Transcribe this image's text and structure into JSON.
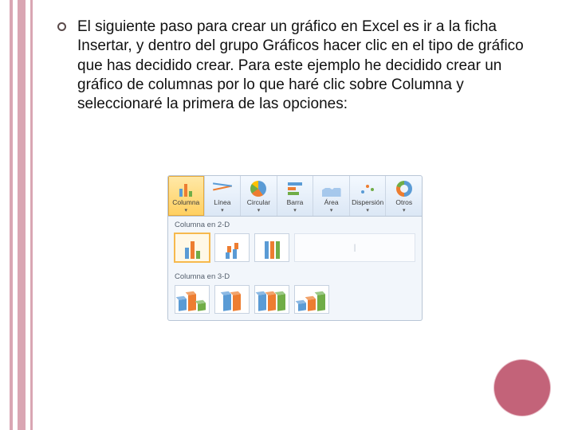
{
  "bullet_text": "El siguiente paso para crear un gráfico en Excel es ir a la ficha Insertar, y dentro del grupo Gráficos hacer clic en el tipo de gráfico que has decidido crear. Para este ejemplo he decidido crear un gráfico de columnas por lo que haré clic sobre Columna y seleccionaré la primera de las opciones:",
  "ribbon": {
    "buttons": [
      {
        "id": "columna",
        "label": "Columna",
        "selected": true
      },
      {
        "id": "linea",
        "label": "Línea",
        "selected": false
      },
      {
        "id": "circular",
        "label": "Circular",
        "selected": false
      },
      {
        "id": "barra",
        "label": "Barra",
        "selected": false
      },
      {
        "id": "area",
        "label": "Área",
        "selected": false
      },
      {
        "id": "dispersion",
        "label": "Dispersión",
        "selected": false
      },
      {
        "id": "otros",
        "label": "Otros",
        "selected": false
      }
    ]
  },
  "gallery": {
    "section_2d": "Columna en 2-D",
    "section_3d": "Columna en 3-D",
    "placeholder_mark": "|"
  }
}
